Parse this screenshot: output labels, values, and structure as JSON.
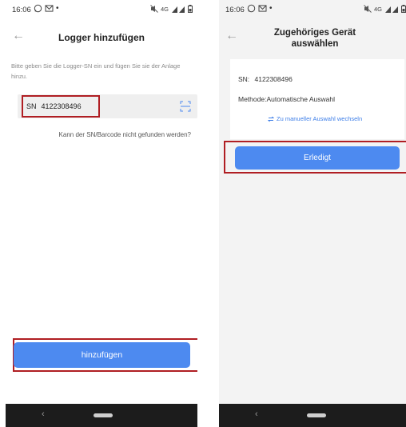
{
  "status_bar": {
    "time": "16:06",
    "network": "4G"
  },
  "left": {
    "title": "Logger hinzufügen",
    "instruction": "Bitte geben Sie die Logger-SN ein und fügen Sie sie der Anlage hinzu.",
    "sn_prefix": "SN",
    "sn_value": "4122308496",
    "cant_find_link": "Kann der SN/Barcode nicht gefunden werden?",
    "add_button": "hinzufügen"
  },
  "right": {
    "title_line1": "Zugehöriges Gerät",
    "title_line2": "auswählen",
    "sn_label": "SN:",
    "sn_value": "4122308496",
    "method_label": "Methode:",
    "method_value": "Automatische Auswahl",
    "switch_link": "Zu manueller Auswahl wechseln",
    "done_button": "Erledigt"
  },
  "colors": {
    "primary": "#4d8af0",
    "highlight": "#b01e23",
    "link": "#3d7ee8"
  },
  "icons": [
    "whatsapp-icon",
    "gmail-icon",
    "mute-icon",
    "signal-icon",
    "battery-icon",
    "back-arrow-icon",
    "scan-icon",
    "switch-icon",
    "nav-back-icon",
    "nav-home-pill-icon"
  ]
}
